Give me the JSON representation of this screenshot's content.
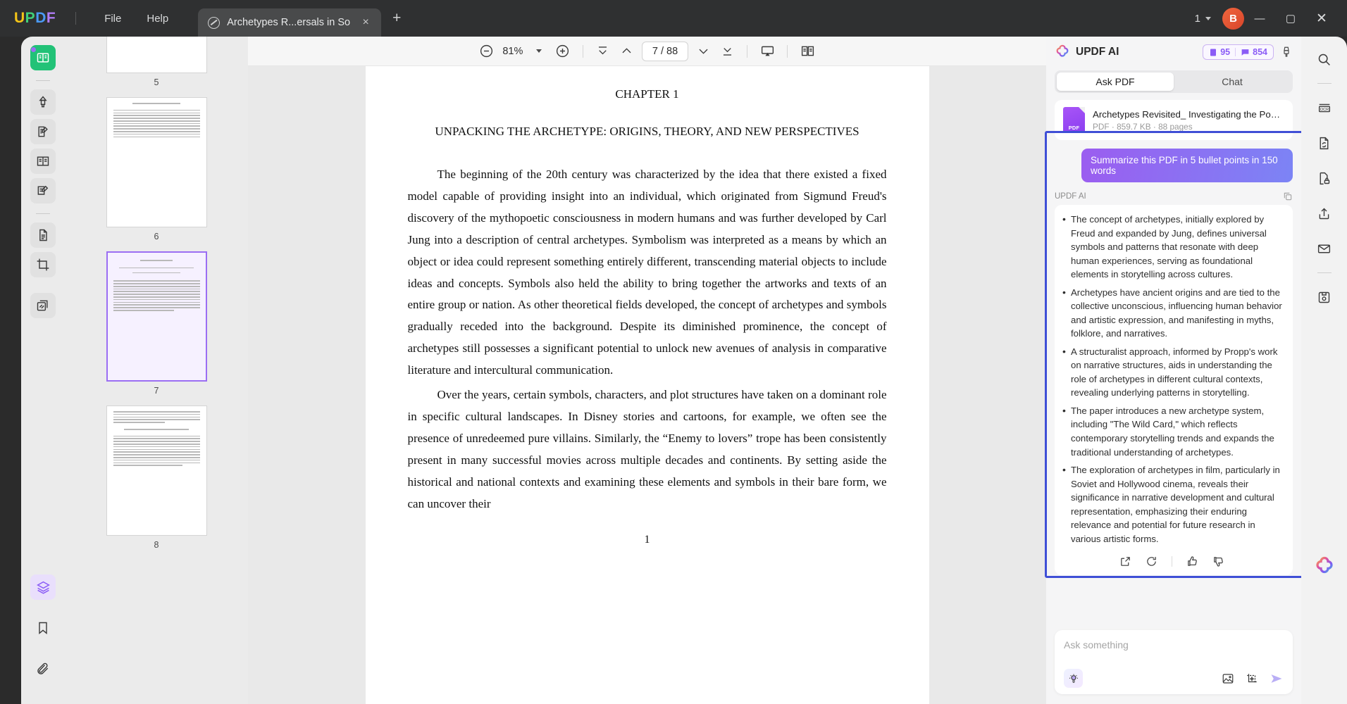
{
  "titlebar": {
    "logo_parts": [
      "U",
      "P",
      "D",
      "F"
    ],
    "menus": [
      "File",
      "Help"
    ],
    "tab_title": "Archetypes R...ersals in So",
    "tab_icon": "slash-circle-icon",
    "tab_close": "×",
    "new_tab": "+",
    "window_count": "1",
    "avatar_initial": "B",
    "minimize": "—",
    "maximize": "▢",
    "close": "✕"
  },
  "left_rail": {
    "items": [
      {
        "name": "reader-tool",
        "icon": "book-reader-icon",
        "state": "active"
      },
      {
        "name": "highlight-tool",
        "icon": "highlighter-icon",
        "state": "normal"
      },
      {
        "name": "edit-pdf-tool",
        "icon": "edit-document-icon",
        "state": "normal"
      },
      {
        "name": "page-layout-tool",
        "icon": "page-columns-icon",
        "state": "normal"
      },
      {
        "name": "comment-tool",
        "icon": "comment-edit-icon",
        "state": "normal"
      },
      {
        "name": "organize-pages-tool",
        "icon": "organize-pages-icon",
        "state": "normal"
      },
      {
        "name": "crop-tool",
        "icon": "crop-icon",
        "state": "normal"
      },
      {
        "name": "batch-tool",
        "icon": "batch-pages-icon",
        "state": "normal"
      }
    ],
    "bottom_items": [
      {
        "name": "layers-panel",
        "icon": "layers-icon",
        "state": "purple"
      },
      {
        "name": "bookmarks-panel",
        "icon": "bookmark-icon",
        "state": "plain"
      },
      {
        "name": "attachments-panel",
        "icon": "paperclip-icon",
        "state": "plain"
      }
    ]
  },
  "toolbar": {
    "zoom_out": "zoom-out-icon",
    "zoom_value": "81%",
    "zoom_dropdown": "chevron-down-icon",
    "zoom_in": "zoom-in-icon",
    "first_page": "first-page-icon",
    "prev_page": "previous-page-icon",
    "page_indicator": "7 / 88",
    "next_page": "next-page-icon",
    "last_page": "last-page-icon",
    "presentation": "presentation-icon",
    "dual_page": "dual-page-view-icon"
  },
  "thumbnails": {
    "pages": [
      {
        "number": "5",
        "selected": false,
        "lines": 0
      },
      {
        "number": "6",
        "selected": false,
        "lines": 12
      },
      {
        "number": "7",
        "selected": true,
        "lines": 16
      },
      {
        "number": "8",
        "selected": false,
        "lines": 20
      }
    ]
  },
  "document": {
    "chapter": "CHAPTER 1",
    "heading": "UNPACKING THE ARCHETYPE: ORIGINS, THEORY, AND NEW PERSPECTIVES",
    "paragraphs": [
      "The beginning of the 20th century was characterized by the idea that there existed a fixed model capable of providing insight into an individual, which originated from Sigmund Freud's discovery of the mythopoetic consciousness in modern humans and was further developed by Carl Jung into a description of central archetypes. Symbolism was interpreted as a means by which an object or idea could represent something entirely different, transcending material objects to include ideas and concepts. Symbols also held the ability to bring together the artworks and texts of an entire group or nation. As other theoretical fields developed, the concept of archetypes and symbols gradually receded into the background. Despite its diminished prominence, the concept of archetypes still possesses a significant potential to unlock new avenues of analysis in comparative literature and intercultural communication.",
      "Over the years, certain symbols, characters, and plot structures have taken on a dominant role in specific cultural landscapes. In Disney stories and cartoons, for example, we often see the presence of unredeemed pure villains. Similarly, the “Enemy to lovers” trope has been consistently present in many successful movies across multiple decades and continents. By setting aside the historical and national contexts and examining these elements and symbols in their bare form, we can uncover their"
    ],
    "folio": "1"
  },
  "ai_panel": {
    "logo": "updf-ai-flower-icon",
    "title": "UPDF AI",
    "badges": [
      {
        "icon": "document-count-icon",
        "value": "95"
      },
      {
        "icon": "chat-count-icon",
        "value": "854"
      }
    ],
    "brush_icon": "brush-icon",
    "tabs": [
      {
        "label": "Ask PDF",
        "active": true
      },
      {
        "label": "Chat",
        "active": false
      }
    ],
    "doc_card": {
      "icon": "pdf-file-icon",
      "name": "Archetypes Revisited_ Investigating the Power of Universal...",
      "meta": "PDF · 859.7 KB · 88 pages"
    },
    "user_message": "Summarize this PDF in 5 bullet points in 150 words",
    "assistant_label": "UPDF AI",
    "copy_icon": "copy-icon",
    "assistant_bullets": [
      "The concept of archetypes, initially explored by Freud and expanded by Jung, defines universal symbols and patterns that resonate with deep human experiences, serving as foundational elements in storytelling across cultures.",
      "Archetypes have ancient origins and are tied to the collective unconscious, influencing human behavior and artistic expression, and manifesting in myths, folklore, and narratives.",
      "A structuralist approach, informed by Propp's work on narrative structures, aids in understanding the role of archetypes in different cultural contexts, revealing underlying patterns in storytelling.",
      "The paper introduces a new archetype system, including \"The Wild Card,\" which reflects contemporary storytelling trends and expands the traditional understanding of archetypes.",
      "The exploration of archetypes in film, particularly in Soviet and Hollywood cinema, reveals their significance in narrative development and cultural representation, emphasizing their enduring relevance and potential for future research in various artistic forms."
    ],
    "answer_actions": [
      {
        "name": "share-answer",
        "icon": "external-link-icon"
      },
      {
        "name": "regenerate-answer",
        "icon": "refresh-icon"
      },
      {
        "name": "thumbs-up",
        "icon": "thumbs-up-icon"
      },
      {
        "name": "thumbs-down",
        "icon": "thumbs-down-icon"
      }
    ],
    "composer": {
      "placeholder": "Ask something",
      "prompt_icon": "lightbulb-icon",
      "image_icon": "image-icon",
      "snapshot_icon": "area-snapshot-icon",
      "send_icon": "send-icon"
    },
    "highlight_color": "#3f4fd6"
  },
  "right_rail": {
    "items": [
      {
        "name": "search-tool",
        "icon": "search-icon"
      },
      {
        "name": "ocr-tool",
        "icon": "ocr-icon"
      },
      {
        "name": "convert-tool",
        "icon": "convert-file-icon"
      },
      {
        "name": "protect-tool",
        "icon": "lock-document-icon"
      },
      {
        "name": "share-tool",
        "icon": "share-upload-icon"
      },
      {
        "name": "email-tool",
        "icon": "email-icon"
      },
      {
        "name": "save-tool",
        "icon": "save-disk-icon"
      }
    ],
    "fab": {
      "name": "updf-ai-fab",
      "icon": "updf-ai-flower-icon"
    }
  },
  "colors": {
    "accent_purple": "#8b5cf6",
    "active_green": "#22c277",
    "highlight_blue": "#3f4fd6",
    "gradient_start": "#9b5df0",
    "gradient_end": "#7c84f5"
  }
}
